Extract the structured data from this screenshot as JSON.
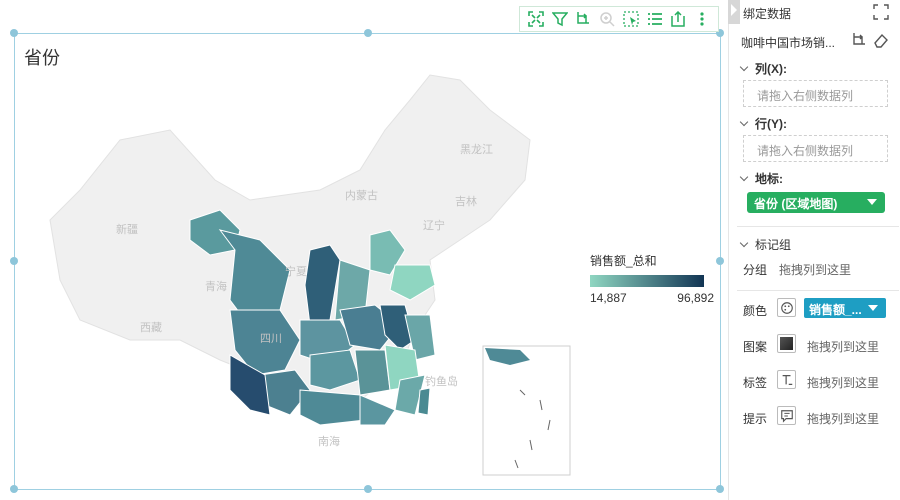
{
  "chart": {
    "title": "省份",
    "legend": {
      "title": "销售额_总和",
      "min": "14,887",
      "max": "96,892",
      "color_low": "#8fd6c1",
      "color_high": "#123554"
    },
    "map_labels": [
      "新疆",
      "西藏",
      "青海",
      "内蒙古",
      "黑龙江",
      "吉林",
      "辽宁",
      "宁夏",
      "四川",
      "南海",
      "钓鱼岛"
    ],
    "toolbar_icons": [
      "fullscreen-icon",
      "filter-icon",
      "drill-icon",
      "zoom-icon",
      "select-icon",
      "list-icon",
      "export-icon",
      "more-icon"
    ]
  },
  "chart_data": {
    "type": "heatmap",
    "title": "省份",
    "legend_title": "销售额_总和",
    "range": [
      14887,
      96892
    ]
  },
  "panel": {
    "title": "绑定数据",
    "dataset": "咖啡中国市场销...",
    "x_section": "列(X):",
    "x_placeholder": "请拖入右侧数据列",
    "y_section": "行(Y):",
    "y_placeholder": "请拖入右侧数据列",
    "geo_section": "地标:",
    "geo_value": "省份 (区域地图)",
    "marks_section": "标记组",
    "group_label": "分组",
    "group_hint": "拖拽列到这里",
    "color_label": "颜色",
    "color_value": "销售额_...",
    "pattern_label": "图案",
    "pattern_hint": "拖拽列到这里",
    "tag_label": "标签",
    "tag_hint": "拖拽列到这里",
    "tip_label": "提示",
    "tip_hint": "拖拽列到这里",
    "accent_green": "#27ae60",
    "accent_blue": "#1e9ec3"
  }
}
